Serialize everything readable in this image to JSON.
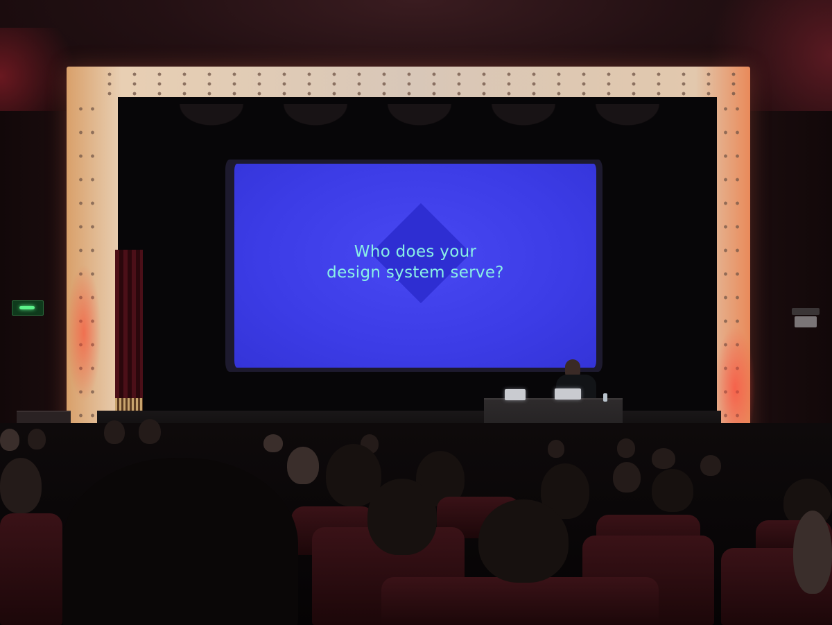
{
  "slide": {
    "line1": "Who does your",
    "line2": "design system serve?"
  },
  "colors": {
    "screen_blue": "#3c3ce6",
    "diamond_blue": "#2e2ed2",
    "slide_text": "#8af0e6",
    "exit_green": "#5cf28a"
  }
}
